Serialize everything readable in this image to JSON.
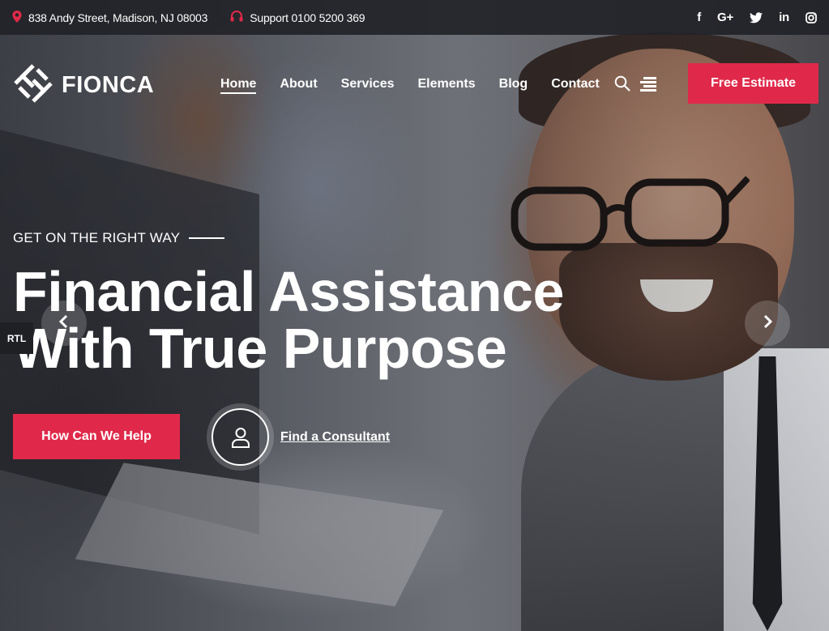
{
  "topbar": {
    "address": "838 Andy Street, Madison, NJ 08003",
    "support": "Support 0100 5200 369",
    "social": [
      {
        "icon": "facebook-icon",
        "glyph": "f"
      },
      {
        "icon": "google-plus-icon",
        "glyph": "G+"
      },
      {
        "icon": "twitter-icon",
        "glyph": ""
      },
      {
        "icon": "linkedin-icon",
        "glyph": "in"
      },
      {
        "icon": "instagram-icon",
        "glyph": ""
      }
    ]
  },
  "brand": {
    "name": "FIONCA",
    "accent_color": "#e0294a"
  },
  "nav": {
    "items": [
      "Home",
      "About",
      "Services",
      "Elements",
      "Blog",
      "Contact"
    ],
    "active": "Home"
  },
  "header": {
    "cta_label": "Free Estimate"
  },
  "hero": {
    "eyebrow": "GET ON THE RIGHT WAY",
    "headline_line1": "Financial Assistance",
    "headline_line2": "With True Purpose",
    "primary_button": "How Can We Help",
    "secondary_link": "Find a Consultant"
  },
  "rtl_label": "RTL"
}
